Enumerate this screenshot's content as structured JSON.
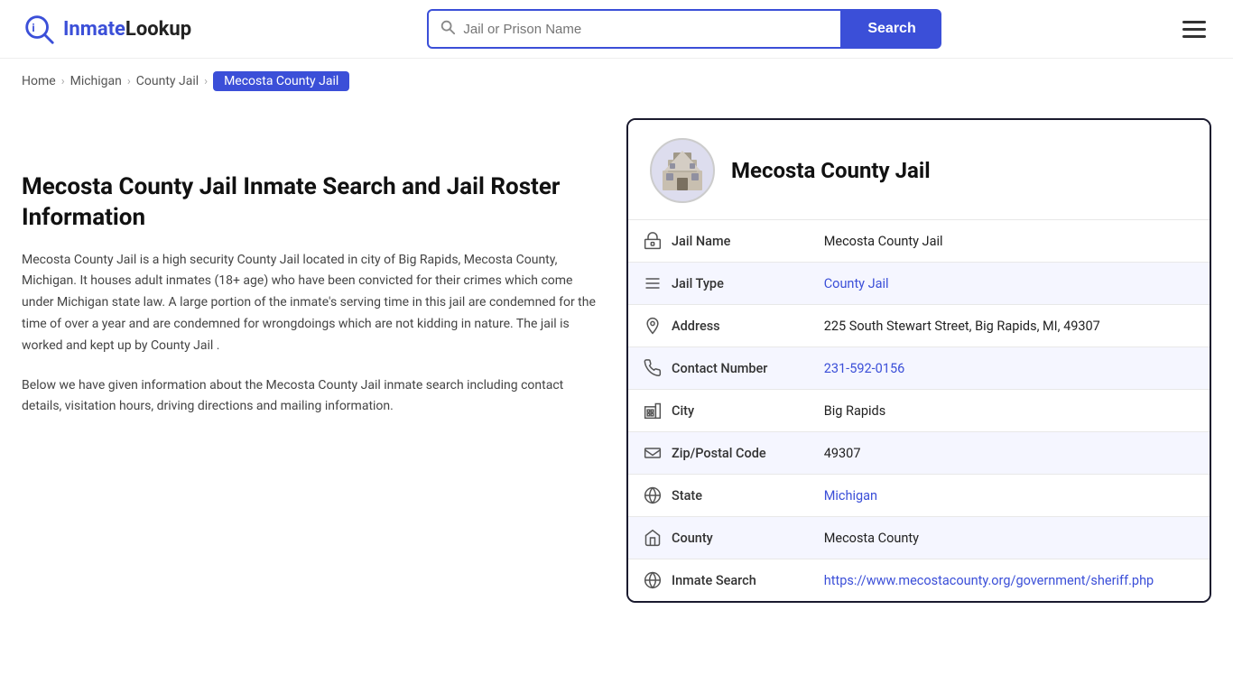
{
  "header": {
    "logo_text_prefix": "Inmate",
    "logo_text_suffix": "Lookup",
    "search_placeholder": "Jail or Prison Name",
    "search_button_label": "Search",
    "menu_icon": "menu"
  },
  "breadcrumb": {
    "items": [
      {
        "label": "Home",
        "href": "#"
      },
      {
        "label": "Michigan",
        "href": "#"
      },
      {
        "label": "County Jail",
        "href": "#"
      },
      {
        "label": "Mecosta County Jail",
        "current": true
      }
    ]
  },
  "left": {
    "heading": "Mecosta County Jail Inmate Search and Jail Roster Information",
    "desc1": "Mecosta County Jail is a high security County Jail located in city of Big Rapids, Mecosta County, Michigan. It houses adult inmates (18+ age) who have been convicted for their crimes which come under Michigan state law. A large portion of the inmate's serving time in this jail are condemned for the time of over a year and are condemned for wrongdoings which are not kidding in nature. The jail is worked and kept up by County Jail .",
    "desc2": "Below we have given information about the Mecosta County Jail inmate search including contact details, visitation hours, driving directions and mailing information."
  },
  "card": {
    "title": "Mecosta County Jail",
    "rows": [
      {
        "icon": "jail",
        "label": "Jail Name",
        "value": "Mecosta County Jail",
        "link": null
      },
      {
        "icon": "list",
        "label": "Jail Type",
        "value": "County Jail",
        "link": "#"
      },
      {
        "icon": "location",
        "label": "Address",
        "value": "225 South Stewart Street, Big Rapids, MI, 49307",
        "link": null
      },
      {
        "icon": "phone",
        "label": "Contact Number",
        "value": "231-592-0156",
        "link": "tel:231-592-0156"
      },
      {
        "icon": "city",
        "label": "City",
        "value": "Big Rapids",
        "link": null
      },
      {
        "icon": "mail",
        "label": "Zip/Postal Code",
        "value": "49307",
        "link": null
      },
      {
        "icon": "globe",
        "label": "State",
        "value": "Michigan",
        "link": "#"
      },
      {
        "icon": "county",
        "label": "County",
        "value": "Mecosta County",
        "link": null
      },
      {
        "icon": "globe2",
        "label": "Inmate Search",
        "value": "https://www.mecostacounty.org/government/sheriff.php",
        "link": "https://www.mecostacounty.org/government/sheriff.php"
      }
    ]
  }
}
